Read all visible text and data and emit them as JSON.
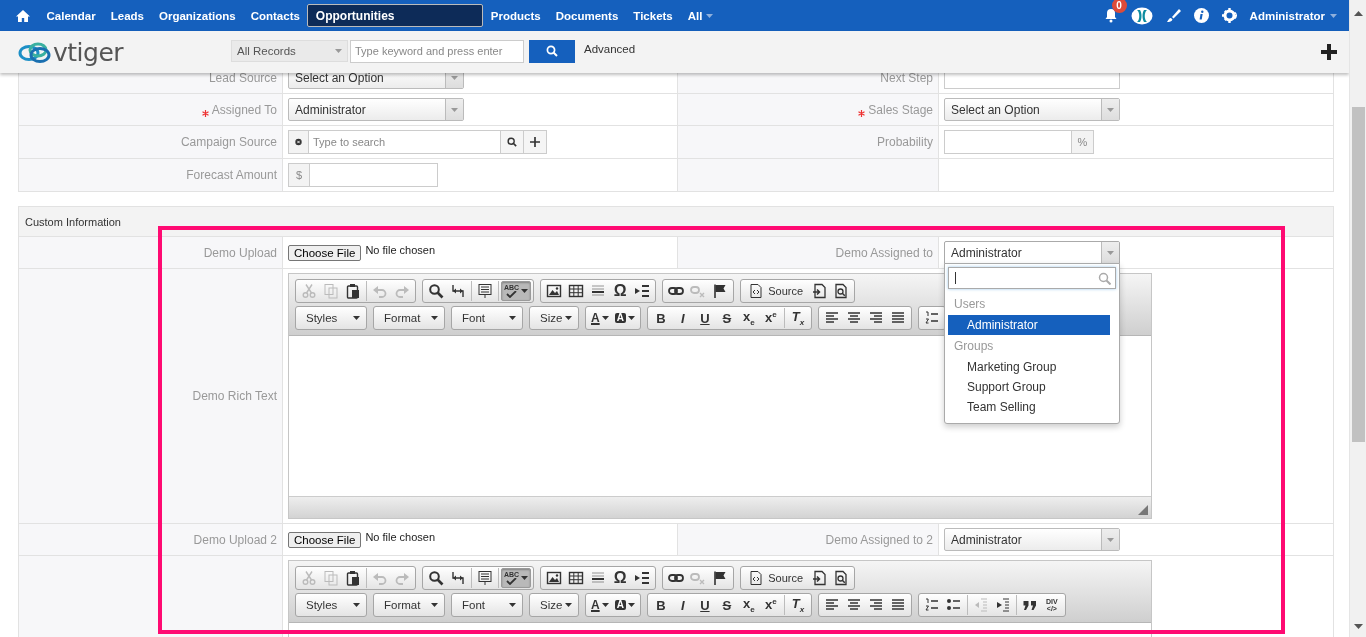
{
  "top_nav": {
    "items": [
      {
        "label": "Calendar",
        "kind": "link",
        "selected": false
      },
      {
        "label": "Leads",
        "kind": "link",
        "selected": false
      },
      {
        "label": "Organizations",
        "kind": "link",
        "selected": false
      },
      {
        "label": "Contacts",
        "kind": "link",
        "selected": false
      },
      {
        "label": "Opportunities",
        "kind": "link",
        "selected": true
      },
      {
        "label": "Products",
        "kind": "link",
        "selected": false
      },
      {
        "label": "Documents",
        "kind": "link",
        "selected": false
      },
      {
        "label": "Tickets",
        "kind": "link",
        "selected": false
      },
      {
        "label": "All",
        "kind": "menu",
        "selected": false
      }
    ],
    "notification_count": "0",
    "user": "Administrator"
  },
  "header": {
    "logo": "vtiger",
    "search_scope": "All Records",
    "search_placeholder": "Type keyword and press enter",
    "advanced_link": "Advanced"
  },
  "form": {
    "blocks": [
      {
        "rows": [
          {
            "kind": "pair",
            "left": {
              "label": "Lead Source",
              "field": {
                "kind": "select",
                "value": "Select an Option"
              }
            },
            "right": {
              "label": "Next Step",
              "field": {
                "kind": "text"
              }
            }
          },
          {
            "kind": "pair",
            "left": {
              "label": "Assigned To",
              "required": true,
              "field": {
                "kind": "select",
                "value": "Administrator"
              }
            },
            "right": {
              "label": "Sales Stage",
              "required": true,
              "field": {
                "kind": "select",
                "value": "Select an Option"
              }
            }
          },
          {
            "kind": "pair",
            "left": {
              "label": "Campaign Source",
              "field": {
                "kind": "reference",
                "placeholder": "Type to search"
              }
            },
            "right": {
              "label": "Probability",
              "field": {
                "kind": "percent",
                "suffix": "%"
              }
            }
          },
          {
            "kind": "pair",
            "left": {
              "label": "Forecast Amount",
              "field": {
                "kind": "currency",
                "prefix": "$"
              }
            }
          }
        ]
      },
      {
        "title": "Custom Information",
        "rows": [
          {
            "kind": "pair",
            "left": {
              "label": "Demo Upload",
              "field": {
                "kind": "file",
                "button": "Choose File",
                "status": "No file chosen"
              }
            },
            "right": {
              "label": "Demo Assigned to",
              "field": {
                "kind": "select",
                "value": "Administrator",
                "open": true,
                "dropdown": {
                  "groups": [
                    {
                      "label": "Users",
                      "options": [
                        {
                          "label": "Administrator",
                          "selected": true
                        }
                      ]
                    },
                    {
                      "label": "Groups",
                      "options": [
                        {
                          "label": "Marketing Group",
                          "selected": false
                        },
                        {
                          "label": "Support Group",
                          "selected": false
                        },
                        {
                          "label": "Team Selling",
                          "selected": false
                        }
                      ]
                    }
                  ]
                }
              }
            }
          },
          {
            "kind": "editor",
            "label": "Demo Rich Text",
            "editor": {
              "resizable": true,
              "toolbar": [
                {
                  "groups": [
                    {
                      "parts": [
                        [
                          {
                            "kind": "cut",
                            "disabled": true,
                            "pressed": false
                          },
                          {
                            "kind": "copy",
                            "disabled": true,
                            "pressed": false
                          },
                          {
                            "kind": "paste",
                            "disabled": false,
                            "pressed": false
                          }
                        ],
                        [
                          {
                            "kind": "undo",
                            "disabled": true,
                            "pressed": false
                          },
                          {
                            "kind": "redo",
                            "disabled": true,
                            "pressed": false
                          }
                        ]
                      ]
                    },
                    {
                      "parts": [
                        [
                          {
                            "kind": "find",
                            "disabled": false,
                            "pressed": false
                          },
                          {
                            "kind": "replace",
                            "disabled": false,
                            "pressed": false
                          }
                        ],
                        [
                          {
                            "kind": "select-all",
                            "disabled": false,
                            "pressed": false
                          }
                        ],
                        [
                          {
                            "kind": "spellcheck",
                            "label": "ABC",
                            "disabled": false,
                            "pressed": true
                          }
                        ]
                      ]
                    },
                    {
                      "parts": [
                        [
                          {
                            "kind": "image",
                            "disabled": false,
                            "pressed": false
                          },
                          {
                            "kind": "table",
                            "disabled": false,
                            "pressed": false
                          },
                          {
                            "kind": "hline",
                            "disabled": false,
                            "pressed": false
                          },
                          {
                            "kind": "special-char",
                            "label": "Ω",
                            "disabled": false,
                            "pressed": false
                          },
                          {
                            "kind": "page-break",
                            "disabled": false,
                            "pressed": false
                          }
                        ]
                      ]
                    },
                    {
                      "parts": [
                        [
                          {
                            "kind": "link",
                            "disabled": false,
                            "pressed": false
                          },
                          {
                            "kind": "unlink",
                            "disabled": true,
                            "pressed": false
                          },
                          {
                            "kind": "anchor",
                            "disabled": false,
                            "pressed": false
                          }
                        ]
                      ]
                    },
                    {
                      "parts": [
                        [
                          {
                            "kind": "source",
                            "label": "Source",
                            "disabled": false,
                            "pressed": false
                          },
                          {
                            "kind": "templates",
                            "disabled": false,
                            "pressed": false
                          },
                          {
                            "kind": "preview",
                            "disabled": false,
                            "pressed": false
                          }
                        ]
                      ]
                    }
                  ]
                },
                {
                  "groups": [
                    {
                      "parts": [
                        [
                          {
                            "kind": "combo",
                            "label": "Styles",
                            "disabled": false,
                            "pressed": false
                          }
                        ]
                      ]
                    },
                    {
                      "parts": [
                        [
                          {
                            "kind": "combo",
                            "label": "Format",
                            "disabled": false,
                            "pressed": false
                          }
                        ]
                      ]
                    },
                    {
                      "parts": [
                        [
                          {
                            "kind": "combo",
                            "label": "Font",
                            "disabled": false,
                            "pressed": false
                          }
                        ]
                      ]
                    },
                    {
                      "parts": [
                        [
                          {
                            "kind": "combo-small",
                            "label": "Size",
                            "disabled": false,
                            "pressed": false
                          }
                        ]
                      ]
                    },
                    {
                      "parts": [
                        [
                          {
                            "kind": "text-color",
                            "label": "A",
                            "disabled": false,
                            "pressed": false
                          },
                          {
                            "kind": "bg-color",
                            "label": "A",
                            "disabled": false,
                            "pressed": false
                          }
                        ]
                      ]
                    },
                    {
                      "parts": [
                        [
                          {
                            "kind": "bold",
                            "label": "B",
                            "disabled": false,
                            "pressed": false
                          },
                          {
                            "kind": "italic",
                            "label": "I",
                            "disabled": false,
                            "pressed": false
                          },
                          {
                            "kind": "underline",
                            "label": "U",
                            "disabled": false,
                            "pressed": false
                          },
                          {
                            "kind": "strike",
                            "label": "S",
                            "disabled": false,
                            "pressed": false
                          },
                          {
                            "kind": "subscript",
                            "label": "x$_{e}$",
                            "disabled": false,
                            "pressed": false
                          },
                          {
                            "kind": "superscript",
                            "label": "x$^{e}$",
                            "disabled": false,
                            "pressed": false
                          }
                        ],
                        [
                          {
                            "kind": "remove-format",
                            "label": "T$_{x}$",
                            "disabled": false,
                            "pressed": false
                          }
                        ]
                      ]
                    },
                    {
                      "parts": [
                        [
                          {
                            "kind": "align-left",
                            "disabled": false,
                            "pressed": false
                          },
                          {
                            "kind": "align-center",
                            "disabled": false,
                            "pressed": false
                          },
                          {
                            "kind": "align-right",
                            "disabled": false,
                            "pressed": false
                          },
                          {
                            "kind": "align-justify",
                            "disabled": false,
                            "pressed": false
                          }
                        ]
                      ]
                    },
                    {
                      "parts": [
                        [
                          {
                            "kind": "numbered-list",
                            "disabled": false,
                            "pressed": false
                          }
                        ]
                      ]
                    }
                  ]
                }
              ]
            }
          },
          {
            "kind": "pair",
            "left": {
              "label": "Demo Upload 2",
              "field": {
                "kind": "file",
                "button": "Choose File",
                "status": "No file chosen"
              }
            },
            "right": {
              "label": "Demo Assigned to 2",
              "field": {
                "kind": "select",
                "value": "Administrator"
              }
            }
          },
          {
            "kind": "editor",
            "editor": {
              "toolbar": [
                {
                  "groups": [
                    {
                      "parts": [
                        [
                          {
                            "kind": "cut",
                            "disabled": true,
                            "pressed": false
                          },
                          {
                            "kind": "copy",
                            "disabled": true,
                            "pressed": false
                          },
                          {
                            "kind": "paste",
                            "disabled": false,
                            "pressed": false
                          }
                        ],
                        [
                          {
                            "kind": "undo",
                            "disabled": true,
                            "pressed": false
                          },
                          {
                            "kind": "redo",
                            "disabled": true,
                            "pressed": false
                          }
                        ]
                      ]
                    },
                    {
                      "parts": [
                        [
                          {
                            "kind": "find",
                            "disabled": false,
                            "pressed": false
                          },
                          {
                            "kind": "replace",
                            "disabled": false,
                            "pressed": false
                          }
                        ],
                        [
                          {
                            "kind": "select-all",
                            "disabled": false,
                            "pressed": false
                          }
                        ],
                        [
                          {
                            "kind": "spellcheck",
                            "label": "ABC",
                            "disabled": false,
                            "pressed": true
                          }
                        ]
                      ]
                    },
                    {
                      "parts": [
                        [
                          {
                            "kind": "image",
                            "disabled": false,
                            "pressed": false
                          },
                          {
                            "kind": "table",
                            "disabled": false,
                            "pressed": false
                          },
                          {
                            "kind": "hline",
                            "disabled": false,
                            "pressed": false
                          },
                          {
                            "kind": "special-char",
                            "label": "Ω",
                            "disabled": false,
                            "pressed": false
                          },
                          {
                            "kind": "page-break",
                            "disabled": false,
                            "pressed": false
                          }
                        ]
                      ]
                    },
                    {
                      "parts": [
                        [
                          {
                            "kind": "link",
                            "disabled": false,
                            "pressed": false
                          },
                          {
                            "kind": "unlink",
                            "disabled": true,
                            "pressed": false
                          },
                          {
                            "kind": "anchor",
                            "disabled": false,
                            "pressed": false
                          }
                        ]
                      ]
                    },
                    {
                      "parts": [
                        [
                          {
                            "kind": "source",
                            "label": "Source",
                            "disabled": false,
                            "pressed": false
                          },
                          {
                            "kind": "templates",
                            "disabled": false,
                            "pressed": false
                          },
                          {
                            "kind": "preview",
                            "disabled": false,
                            "pressed": false
                          }
                        ]
                      ]
                    }
                  ]
                },
                {
                  "groups": [
                    {
                      "parts": [
                        [
                          {
                            "kind": "combo",
                            "label": "Styles",
                            "disabled": false,
                            "pressed": false
                          }
                        ]
                      ]
                    },
                    {
                      "parts": [
                        [
                          {
                            "kind": "combo",
                            "label": "Format",
                            "disabled": false,
                            "pressed": false
                          }
                        ]
                      ]
                    },
                    {
                      "parts": [
                        [
                          {
                            "kind": "combo",
                            "label": "Font",
                            "disabled": false,
                            "pressed": false
                          }
                        ]
                      ]
                    },
                    {
                      "parts": [
                        [
                          {
                            "kind": "combo-small",
                            "label": "Size",
                            "disabled": false,
                            "pressed": false
                          }
                        ]
                      ]
                    },
                    {
                      "parts": [
                        [
                          {
                            "kind": "text-color",
                            "label": "A",
                            "disabled": false,
                            "pressed": false
                          },
                          {
                            "kind": "bg-color",
                            "label": "A",
                            "disabled": false,
                            "pressed": false
                          }
                        ]
                      ]
                    },
                    {
                      "parts": [
                        [
                          {
                            "kind": "bold",
                            "label": "B",
                            "disabled": false,
                            "pressed": false
                          },
                          {
                            "kind": "italic",
                            "label": "I",
                            "disabled": false,
                            "pressed": false
                          },
                          {
                            "kind": "underline",
                            "label": "U",
                            "disabled": false,
                            "pressed": false
                          },
                          {
                            "kind": "strike",
                            "label": "S",
                            "disabled": false,
                            "pressed": false
                          },
                          {
                            "kind": "subscript",
                            "label": "x$_{e}$",
                            "disabled": false,
                            "pressed": false
                          },
                          {
                            "kind": "superscript",
                            "label": "x$^{e}$",
                            "disabled": false,
                            "pressed": false
                          }
                        ],
                        [
                          {
                            "kind": "remove-format",
                            "label": "T$_{x}$",
                            "disabled": false,
                            "pressed": false
                          }
                        ]
                      ]
                    },
                    {
                      "parts": [
                        [
                          {
                            "kind": "align-left",
                            "disabled": false,
                            "pressed": false
                          },
                          {
                            "kind": "align-center",
                            "disabled": false,
                            "pressed": false
                          },
                          {
                            "kind": "align-right",
                            "disabled": false,
                            "pressed": false
                          },
                          {
                            "kind": "align-justify",
                            "disabled": false,
                            "pressed": false
                          }
                        ]
                      ]
                    },
                    {
                      "parts": [
                        [
                          {
                            "kind": "numbered-list",
                            "disabled": false,
                            "pressed": false
                          },
                          {
                            "kind": "bulleted-list",
                            "disabled": false,
                            "pressed": false
                          }
                        ],
                        [
                          {
                            "kind": "outdent",
                            "disabled": true,
                            "pressed": false
                          },
                          {
                            "kind": "indent",
                            "disabled": false,
                            "pressed": false
                          }
                        ],
                        [
                          {
                            "kind": "blockquote",
                            "disabled": false,
                            "pressed": false
                          },
                          {
                            "kind": "div",
                            "label": "DIV",
                            "sublabel": "</>",
                            "disabled": false,
                            "pressed": false
                          }
                        ]
                      ]
                    }
                  ]
                }
              ]
            }
          }
        ]
      }
    ]
  }
}
